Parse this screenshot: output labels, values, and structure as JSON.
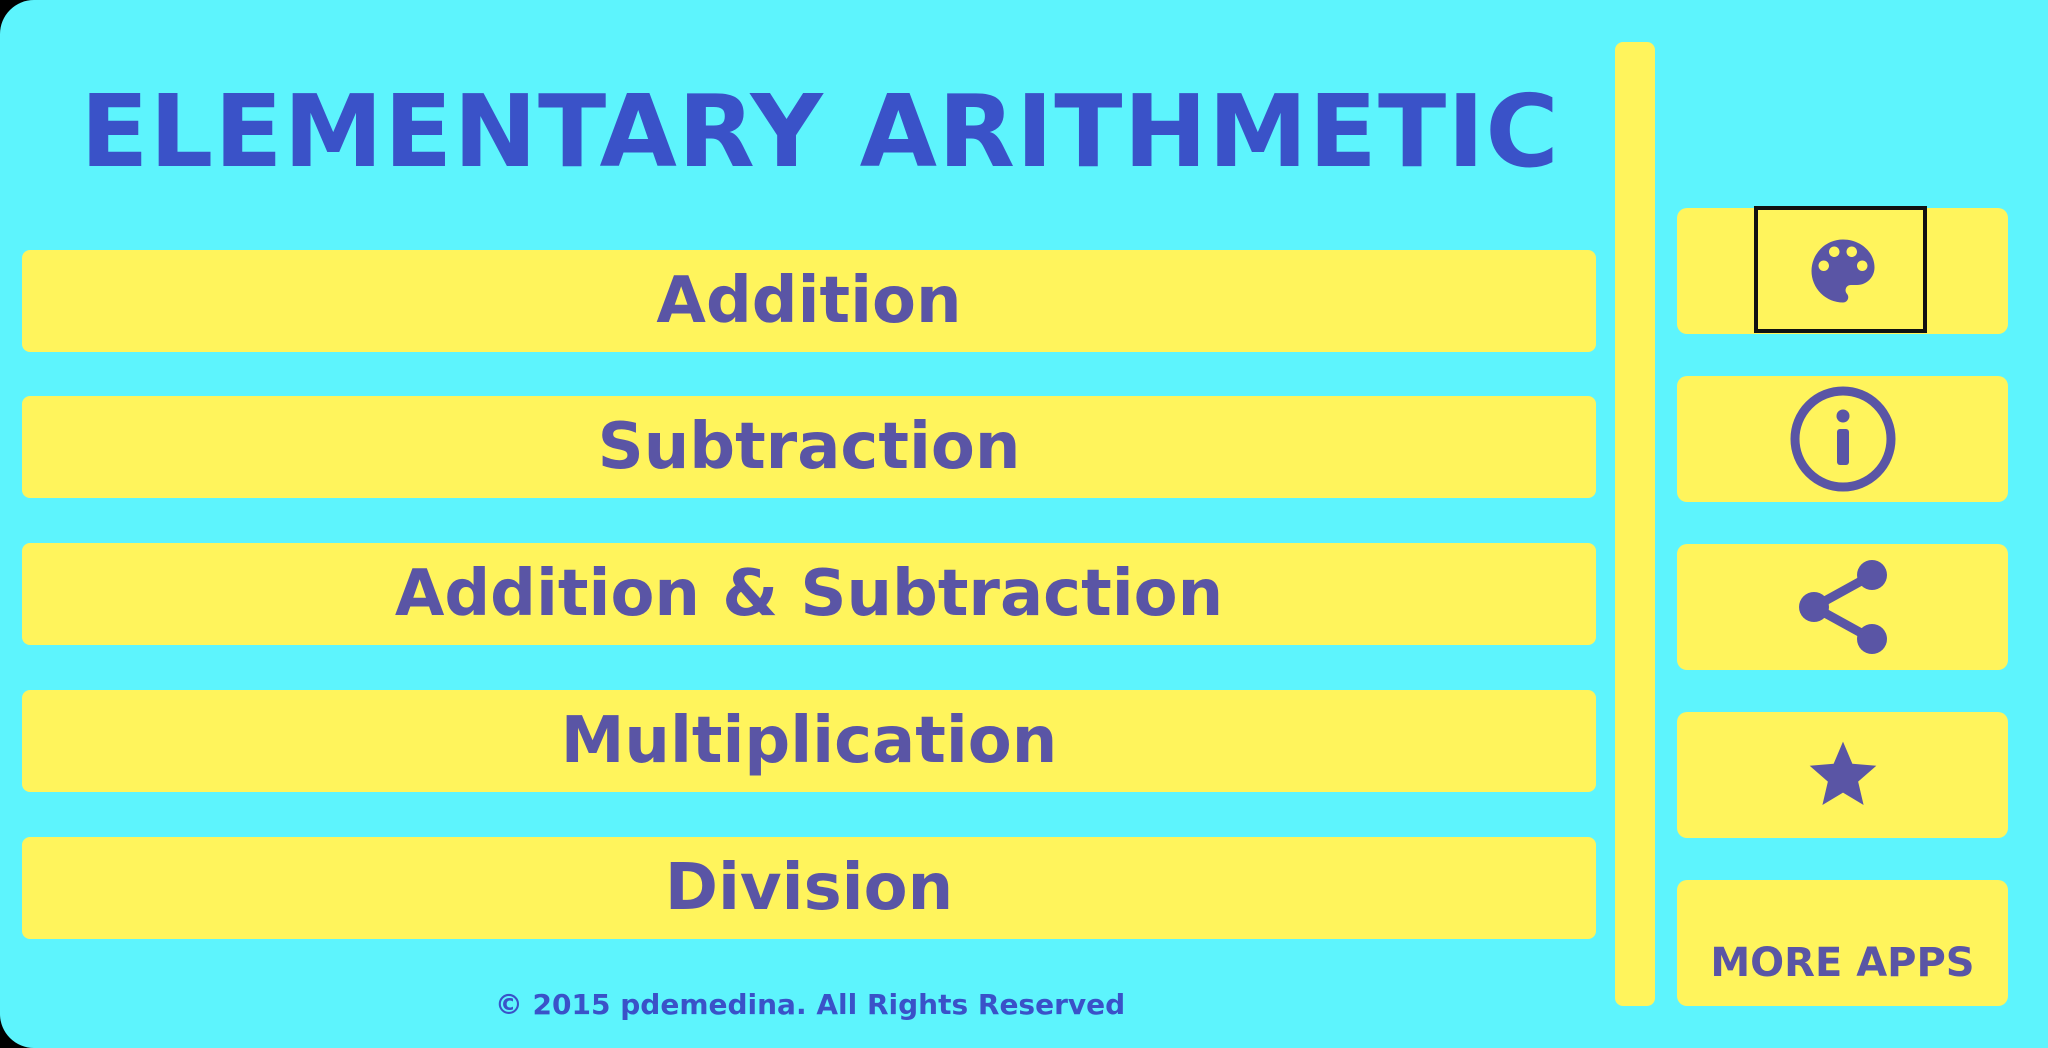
{
  "app": {
    "title": "ELEMENTARY ARITHMETIC",
    "copyright": "© 2015 pdemedina. All Rights Reserved"
  },
  "menu": {
    "items": [
      {
        "label": "Addition"
      },
      {
        "label": "Subtraction"
      },
      {
        "label": "Addition & Subtraction"
      },
      {
        "label": "Multiplication"
      },
      {
        "label": "Division"
      }
    ]
  },
  "sidebar": {
    "buttons": [
      {
        "icon": "palette-icon",
        "focused": true
      },
      {
        "icon": "info-icon"
      },
      {
        "icon": "share-icon"
      },
      {
        "icon": "star-icon"
      }
    ],
    "more_apps_label": "MORE APPS"
  },
  "colors": {
    "background": "#5df4fd",
    "button": "#fff45c",
    "title_text": "#3a52c8",
    "button_text": "#5a55a5"
  }
}
